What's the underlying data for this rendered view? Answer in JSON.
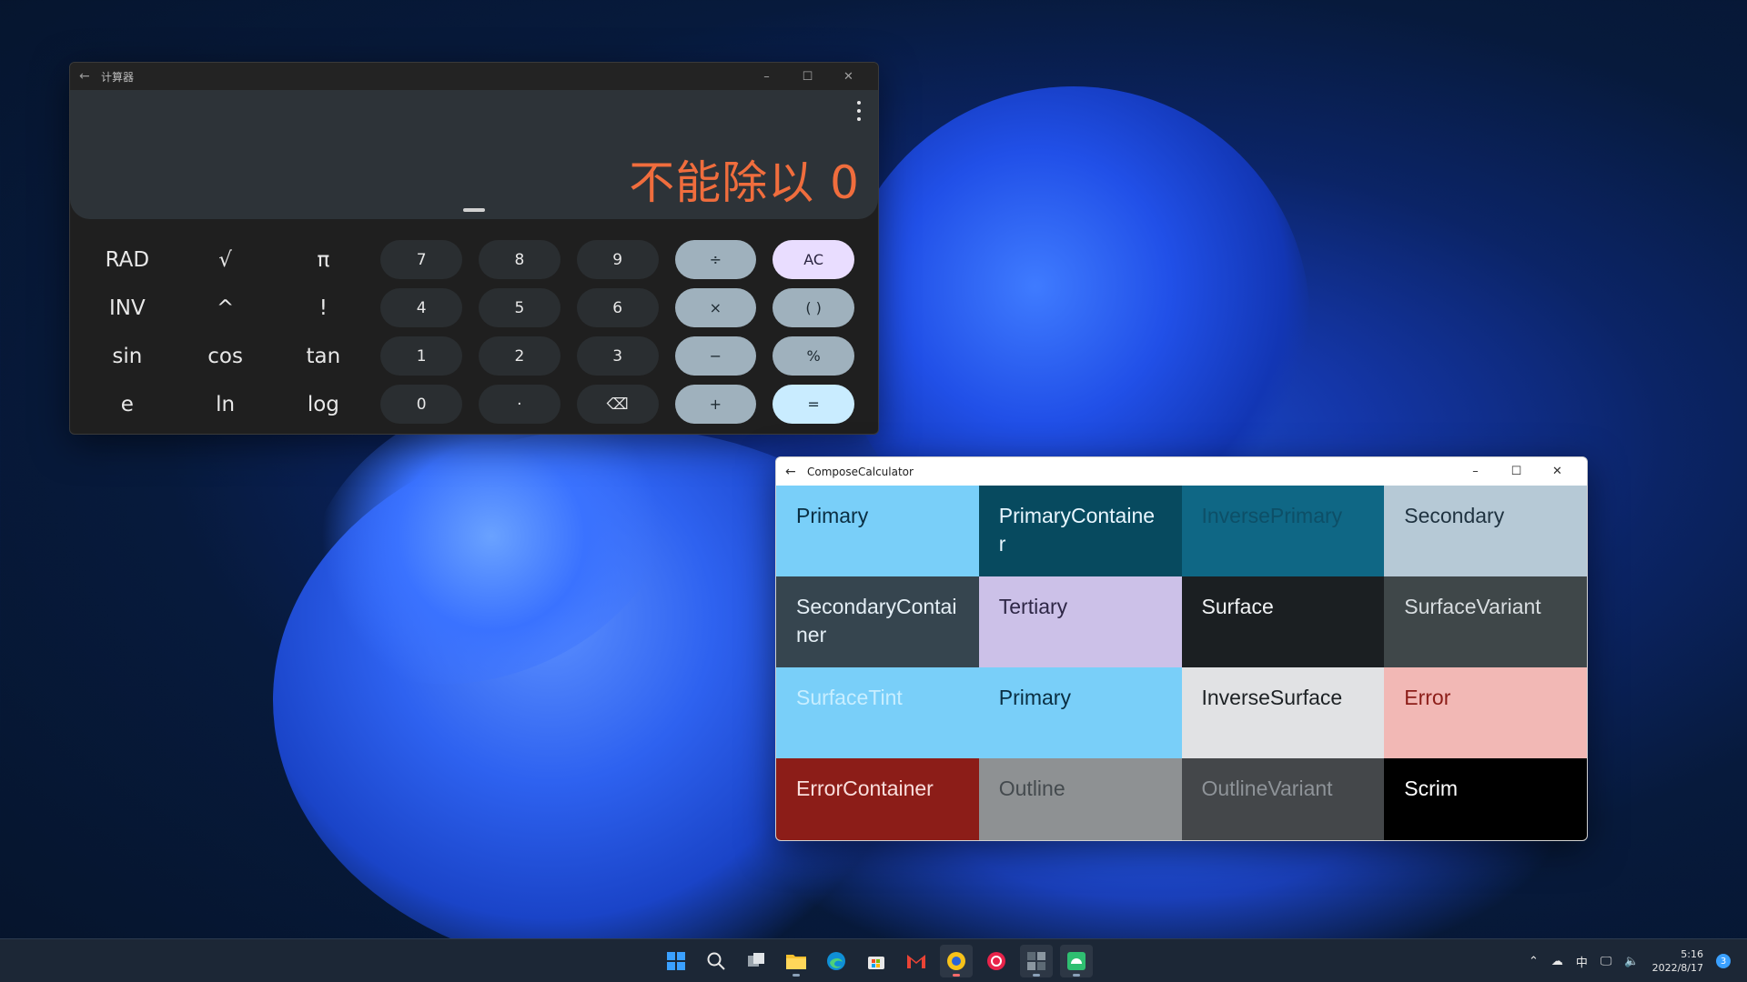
{
  "calculator": {
    "title": "计算器",
    "display": "不能除以 0",
    "controls": {
      "minimize": "–",
      "maximize": "☐",
      "close": "✕",
      "back": "←"
    },
    "keys": [
      {
        "label": "RAD",
        "kind": "sci"
      },
      {
        "label": "√",
        "kind": "sci"
      },
      {
        "label": "π",
        "kind": "sci"
      },
      {
        "label": "7",
        "kind": "num"
      },
      {
        "label": "8",
        "kind": "num"
      },
      {
        "label": "9",
        "kind": "num"
      },
      {
        "label": "÷",
        "kind": "op"
      },
      {
        "label": "AC",
        "kind": "ac"
      },
      {
        "label": "INV",
        "kind": "sci"
      },
      {
        "label": "^",
        "kind": "sci"
      },
      {
        "label": "!",
        "kind": "sci"
      },
      {
        "label": "4",
        "kind": "num"
      },
      {
        "label": "5",
        "kind": "num"
      },
      {
        "label": "6",
        "kind": "num"
      },
      {
        "label": "×",
        "kind": "op"
      },
      {
        "label": "( )",
        "kind": "op2"
      },
      {
        "label": "sin",
        "kind": "sci"
      },
      {
        "label": "cos",
        "kind": "sci"
      },
      {
        "label": "tan",
        "kind": "sci"
      },
      {
        "label": "1",
        "kind": "num"
      },
      {
        "label": "2",
        "kind": "num"
      },
      {
        "label": "3",
        "kind": "num"
      },
      {
        "label": "−",
        "kind": "op"
      },
      {
        "label": "%",
        "kind": "op2"
      },
      {
        "label": "e",
        "kind": "sci"
      },
      {
        "label": "ln",
        "kind": "sci"
      },
      {
        "label": "log",
        "kind": "sci"
      },
      {
        "label": "0",
        "kind": "num"
      },
      {
        "label": "·",
        "kind": "num"
      },
      {
        "label": "⌫",
        "kind": "num"
      },
      {
        "label": "+",
        "kind": "op"
      },
      {
        "label": "=",
        "kind": "eq"
      }
    ]
  },
  "compose": {
    "title": "ComposeCalculator",
    "controls": {
      "minimize": "–",
      "maximize": "☐",
      "close": "✕",
      "back": "←"
    },
    "swatches": [
      {
        "label": "Primary",
        "bg": "#79cff9",
        "fg": "#0a2e42"
      },
      {
        "label": "PrimaryContainer",
        "bg": "#074a5f",
        "fg": "#e8f6ff"
      },
      {
        "label": "InversePrimary",
        "bg": "#0f6785",
        "fg": "#0d4f67"
      },
      {
        "label": "Secondary",
        "bg": "#b6c9d6",
        "fg": "#1f3240"
      },
      {
        "label": "SecondaryContainer",
        "bg": "#36454f",
        "fg": "#e4eef5"
      },
      {
        "label": "Tertiary",
        "bg": "#ccc1e8",
        "fg": "#2e2746"
      },
      {
        "label": "Surface",
        "bg": "#1b1f22",
        "fg": "#f0f2f4"
      },
      {
        "label": "SurfaceVariant",
        "bg": "#3f4749",
        "fg": "#d8dde0"
      },
      {
        "label": "SurfaceTint",
        "bg": "#79cff9",
        "fg": "#c8eeff"
      },
      {
        "label": "Primary",
        "bg": "#79cff9",
        "fg": "#0a2e42"
      },
      {
        "label": "InverseSurface",
        "bg": "#e1e2e4",
        "fg": "#1d2124"
      },
      {
        "label": "Error",
        "bg": "#f2b8b5",
        "fg": "#8c1d18"
      },
      {
        "label": "ErrorContainer",
        "bg": "#8c1d18",
        "fg": "#f9dedc"
      },
      {
        "label": "Outline",
        "bg": "#8e9193",
        "fg": "#444a4e"
      },
      {
        "label": "OutlineVariant",
        "bg": "#44474a",
        "fg": "#8e9398"
      },
      {
        "label": "Scrim",
        "bg": "#000000",
        "fg": "#ffffff"
      }
    ]
  },
  "taskbar": {
    "apps": [
      "windows-start",
      "search",
      "task-view",
      "file-explorer",
      "edge",
      "store",
      "gmail",
      "app-yellow",
      "app-red",
      "calculator-app",
      "android-app"
    ],
    "tray": {
      "ime": "中",
      "time": "5:16",
      "date": "2022/8/17",
      "notifications": "3"
    }
  }
}
